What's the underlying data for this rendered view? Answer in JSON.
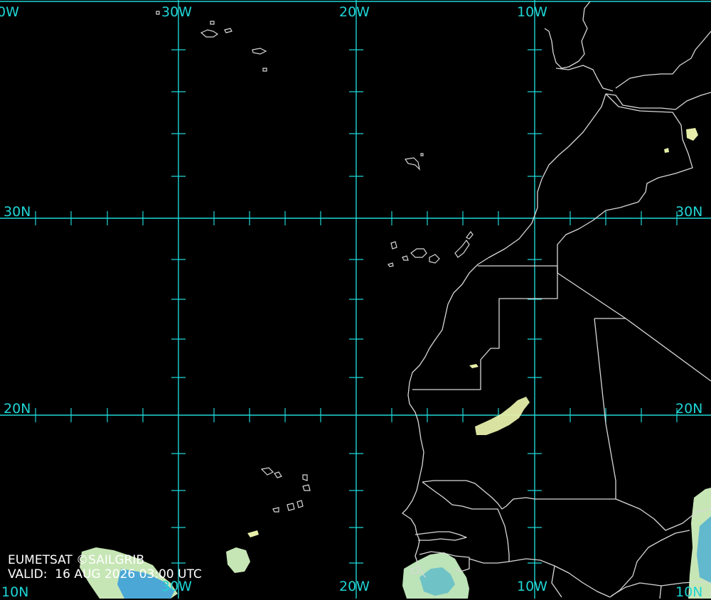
{
  "map": {
    "longitude_labels": [
      "30W",
      "20W",
      "10W"
    ],
    "latitude_labels": [
      "30N",
      "20N"
    ],
    "edge_labels": {
      "top_left": "0W",
      "bottom_left": "10N",
      "bottom_right": "10N"
    },
    "colors": {
      "background": "#000000",
      "graticule": "#1fd5d5",
      "coastline": "#d8d8d8",
      "cloud_light": "#e9f0b0",
      "cloud_mid": "#7fcbc0",
      "cloud_dense": "#3a9fd8"
    }
  },
  "credit": {
    "source": "EUMETSAT ©SAILGRIB",
    "valid": "VALID:  16 AUG 2026 03:00 UTC"
  }
}
